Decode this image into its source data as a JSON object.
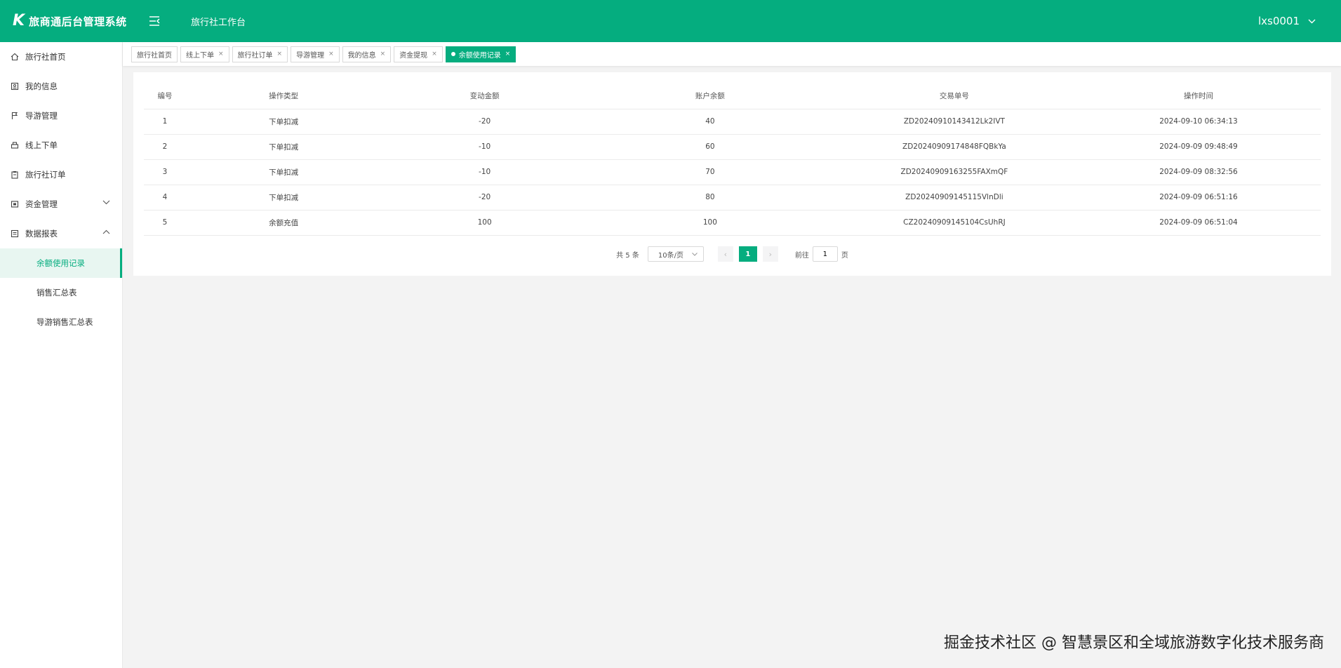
{
  "header": {
    "logo_mark": "K",
    "app_title": "旅商通后台管理系统",
    "workspace_title": "旅行社工作台",
    "username": "lxs0001"
  },
  "sidebar": {
    "items": [
      {
        "label": "旅行社首页",
        "icon": "home-icon"
      },
      {
        "label": "我的信息",
        "icon": "profile-icon"
      },
      {
        "label": "导游管理",
        "icon": "flag-icon"
      },
      {
        "label": "线上下单",
        "icon": "order-icon"
      },
      {
        "label": "旅行社订单",
        "icon": "clipboard-icon"
      },
      {
        "label": "资金管理",
        "icon": "wallet-icon"
      },
      {
        "label": "数据报表",
        "icon": "report-icon"
      }
    ],
    "sub_items": [
      {
        "label": "余额使用记录"
      },
      {
        "label": "销售汇总表"
      },
      {
        "label": "导游销售汇总表"
      }
    ]
  },
  "tabs": [
    {
      "label": "旅行社首页"
    },
    {
      "label": "线上下单"
    },
    {
      "label": "旅行社订单"
    },
    {
      "label": "导游管理"
    },
    {
      "label": "我的信息"
    },
    {
      "label": "资金提现"
    },
    {
      "label": "余额使用记录"
    }
  ],
  "table": {
    "headers": [
      "编号",
      "操作类型",
      "变动金额",
      "账户余额",
      "交易单号",
      "操作时间"
    ],
    "rows": [
      [
        "1",
        "下单扣减",
        "-20",
        "40",
        "ZD20240910143412Lk2IVT",
        "2024-09-10 06:34:13"
      ],
      [
        "2",
        "下单扣减",
        "-10",
        "60",
        "ZD20240909174848FQBkYa",
        "2024-09-09 09:48:49"
      ],
      [
        "3",
        "下单扣减",
        "-10",
        "70",
        "ZD20240909163255FAXmQF",
        "2024-09-09 08:32:56"
      ],
      [
        "4",
        "下单扣减",
        "-20",
        "80",
        "ZD20240909145115VlnDli",
        "2024-09-09 06:51:16"
      ],
      [
        "5",
        "余额充值",
        "100",
        "100",
        "CZ20240909145104CsUhRJ",
        "2024-09-09 06:51:04"
      ]
    ]
  },
  "pagination": {
    "total": "共 5 条",
    "page_size": "10条/页",
    "current_page": "1",
    "goto_label": "前往",
    "goto_value": "1",
    "page_unit": "页"
  },
  "watermark": "掘金技术社区 @ 智慧景区和全域旅游数字化技术服务商",
  "colors": {
    "brand": "#05ad7f"
  }
}
